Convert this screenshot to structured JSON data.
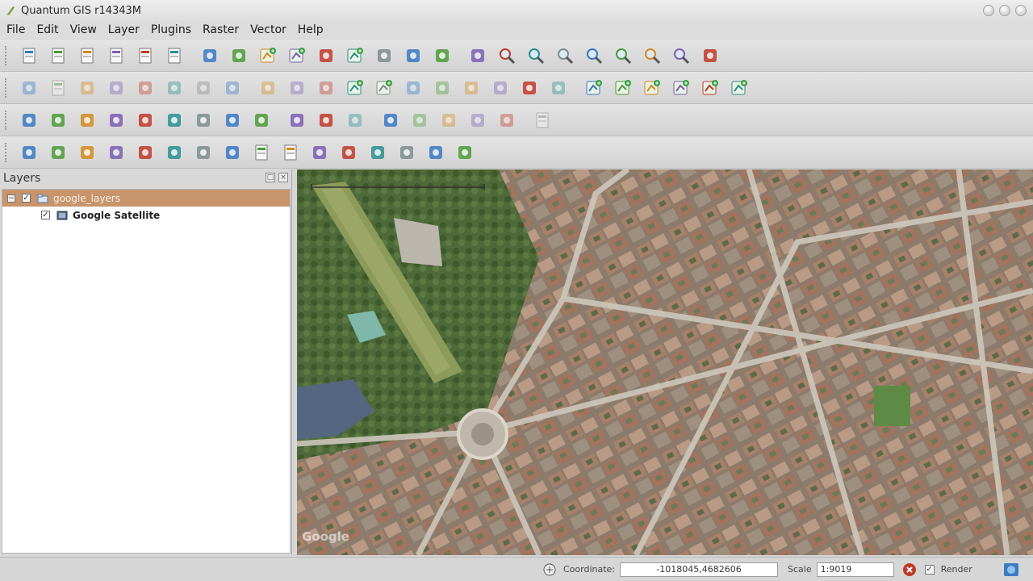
{
  "window": {
    "title": "Quantum GIS r14343M"
  },
  "menu": [
    "File",
    "Edit",
    "View",
    "Layer",
    "Plugins",
    "Raster",
    "Vector",
    "Help"
  ],
  "layers_panel": {
    "title": "Layers",
    "group": {
      "label": "google_layers",
      "checked": true
    },
    "layer": {
      "label": "Google Satellite",
      "checked": true
    }
  },
  "statusbar": {
    "coordinate_label": "Coordinate:",
    "coordinate_value": "-1018045,4682606",
    "scale_label": "Scale",
    "scale_value": "1:9019",
    "render_label": "Render"
  },
  "map": {
    "watermark": "Google"
  },
  "toolbars": {
    "row1": [
      "new-project-icon",
      "open-project-icon",
      "save-project-icon",
      "save-as-icon",
      "print-composer-icon",
      "print-icon",
      "sep",
      "digitize-icon",
      "edit-layer-icon",
      "add-feature-icon",
      "add-part-icon",
      "move-feature-icon",
      "add-ring-icon",
      "delete-part-icon",
      "node-tool-icon",
      "split-icon",
      "sep",
      "pan-icon",
      "zoom-in-icon",
      "zoom-out-icon",
      "zoom-full-icon",
      "zoom-selection-icon",
      "zoom-layer-icon",
      "zoom-last-icon",
      "zoom-next-icon",
      "refresh-icon"
    ],
    "row2": [
      "pencil-icon",
      "save-edits-icon",
      "move-icon",
      "node-icon",
      "delete-icon",
      "cut-icon",
      "copy-icon",
      "paste-icon",
      "sep",
      "undo-icon",
      "redo-icon",
      "simplify-icon",
      "add-ring-icon",
      "add-part-icon",
      "fill-ring-icon",
      "delete-ring-icon",
      "reshape-icon",
      "offset-icon",
      "split-icon",
      "merge-icon",
      "sep",
      "add-vector-icon",
      "add-raster-icon",
      "add-postgis-icon",
      "add-spatialite-icon",
      "add-wms-icon",
      "add-wfs-icon"
    ],
    "row3": [
      "identify-icon",
      "select-icon",
      "deselect-icon",
      "attribute-table-icon",
      "measure-icon",
      "annotation-icon",
      "map-tips-icon",
      "bookmark-icon",
      "text-annotation-icon",
      "sep",
      "label-icon",
      "pin-label-icon",
      "rotate-label-icon",
      "sep",
      "move-label-icon",
      "show-label-icon",
      "change-label-icon",
      "rotate-icon",
      "properties-icon",
      "sep2",
      "form-icon"
    ],
    "row4": [
      "raster-calc-icon",
      "georeferencer-icon",
      "interpolation-icon",
      "heatmap-icon",
      "globe-icon",
      "histogram-icon",
      "gps-icon",
      "coordinate-capture-icon",
      "dxf-export-icon",
      "pdf-export-icon",
      "edit-attr-icon",
      "line-tool-icon",
      "road-graph-icon",
      "bus-icon",
      "map-server-icon",
      "binoculars-icon"
    ]
  }
}
